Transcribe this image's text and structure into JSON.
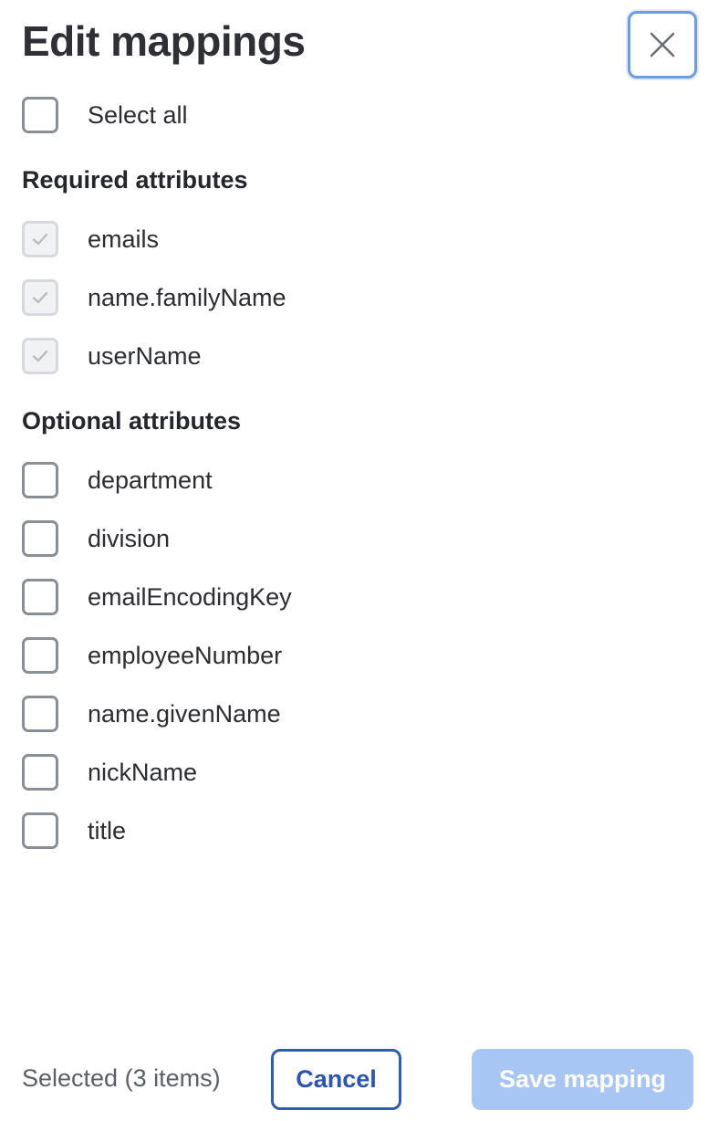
{
  "dialog": {
    "title": "Edit mappings",
    "close_icon": "close-icon"
  },
  "select_all": {
    "label": "Select all",
    "checked": false
  },
  "required": {
    "heading": "Required attributes",
    "items": [
      {
        "label": "emails",
        "checked": true,
        "disabled": true
      },
      {
        "label": "name.familyName",
        "checked": true,
        "disabled": true
      },
      {
        "label": "userName",
        "checked": true,
        "disabled": true
      }
    ]
  },
  "optional": {
    "heading": "Optional attributes",
    "items": [
      {
        "label": "department",
        "checked": false
      },
      {
        "label": "division",
        "checked": false
      },
      {
        "label": "emailEncodingKey",
        "checked": false
      },
      {
        "label": "employeeNumber",
        "checked": false
      },
      {
        "label": "name.givenName",
        "checked": false
      },
      {
        "label": "nickName",
        "checked": false
      },
      {
        "label": "title",
        "checked": false
      }
    ]
  },
  "footer": {
    "status": "Selected (3 items)",
    "cancel_label": "Cancel",
    "save_label": "Save mapping"
  },
  "colors": {
    "primary": "#2f5cb8",
    "primary_disabled": "#a8c6f4",
    "focus_ring": "#6d9ce6"
  }
}
